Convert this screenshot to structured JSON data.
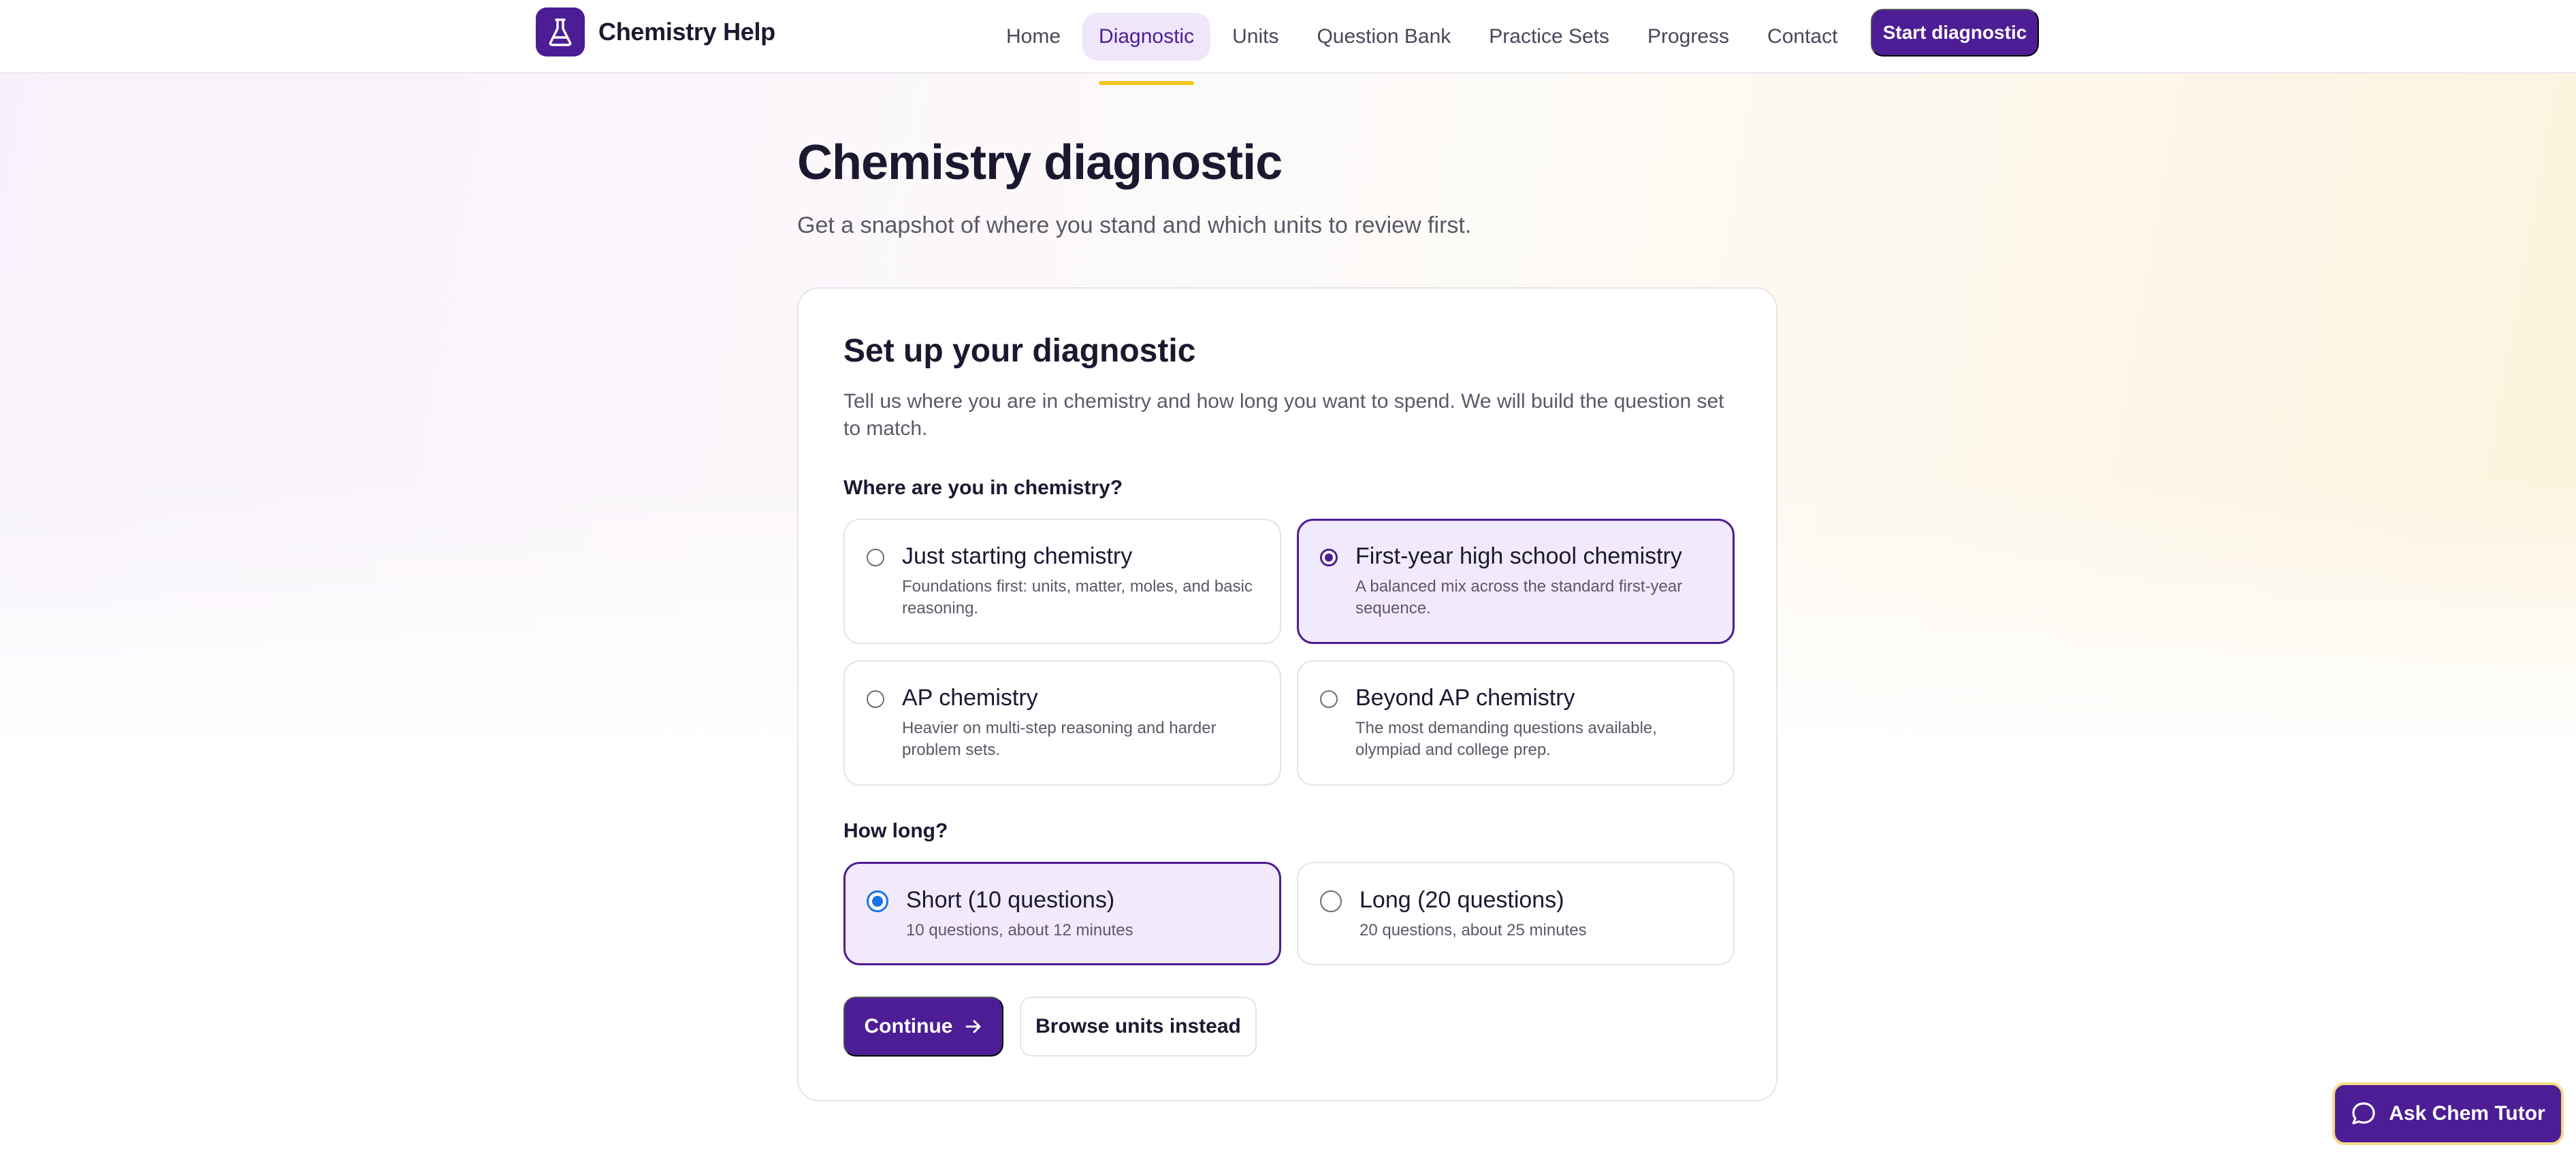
{
  "brand": {
    "name": "Chemistry Help",
    "icon": "flask-icon"
  },
  "nav": {
    "items": [
      {
        "label": "Home"
      },
      {
        "label": "Diagnostic",
        "active": true
      },
      {
        "label": "Units"
      },
      {
        "label": "Question Bank"
      },
      {
        "label": "Practice Sets"
      },
      {
        "label": "Progress"
      },
      {
        "label": "Contact"
      }
    ],
    "cta_label": "Start diagnostic"
  },
  "header": {
    "title": "Chemistry diagnostic",
    "subtitle": "Get a snapshot of where you stand and which units to review first."
  },
  "setup": {
    "title": "Set up your diagnostic",
    "description": "Tell us where you are in chemistry and how long you want to spend. We will build the question set to match.",
    "level_label": "Where are you in chemistry?",
    "levels": [
      {
        "title": "Just starting chemistry",
        "description": "Foundations first: units, matter, moles, and basic reasoning.",
        "selected": false
      },
      {
        "title": "First-year high school chemistry",
        "description": "A balanced mix across the standard first-year sequence.",
        "selected": true
      },
      {
        "title": "AP chemistry",
        "description": "Heavier on multi-step reasoning and harder problem sets.",
        "selected": false
      },
      {
        "title": "Beyond AP chemistry",
        "description": "The most demanding questions available, olympiad and college prep.",
        "selected": false
      }
    ],
    "length_label": "How long?",
    "lengths": [
      {
        "title": "Short (10 questions)",
        "description": "10 questions, about 12 minutes",
        "selected": true
      },
      {
        "title": "Long (20 questions)",
        "description": "20 questions, about 25 minutes",
        "selected": false
      }
    ],
    "continue_label": "Continue",
    "browse_label": "Browse units instead"
  },
  "tutor": {
    "label": "Ask Chem Tutor",
    "icon": "chat-bubble-icon"
  },
  "colors": {
    "brand": "#4c1d95",
    "accent": "#f3c623",
    "selected_bg": "#f1eafd",
    "radio_blue": "#1a73e8"
  }
}
